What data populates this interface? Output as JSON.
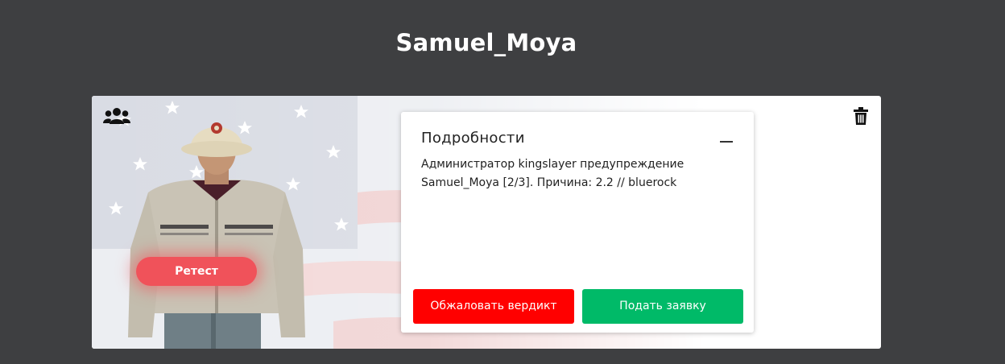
{
  "header": {
    "title": "Samuel_Moya"
  },
  "profile": {
    "retest_label": "Ретест",
    "players_icon": "users-icon",
    "delete_icon": "trash-icon"
  },
  "details": {
    "title": "Подробности",
    "text": "Администратор kingslayer предупреждение Samuel_Moya [2/3]. Причина: 2.2 // bluerock",
    "collapse_icon": "minus-icon",
    "appeal_button": "Обжаловать вердикт",
    "submit_button": "Подать заявку"
  },
  "colors": {
    "page_bg": "#3e3f41",
    "retest": "#f0525a",
    "appeal": "#ff0000",
    "submit": "#00ba68"
  }
}
